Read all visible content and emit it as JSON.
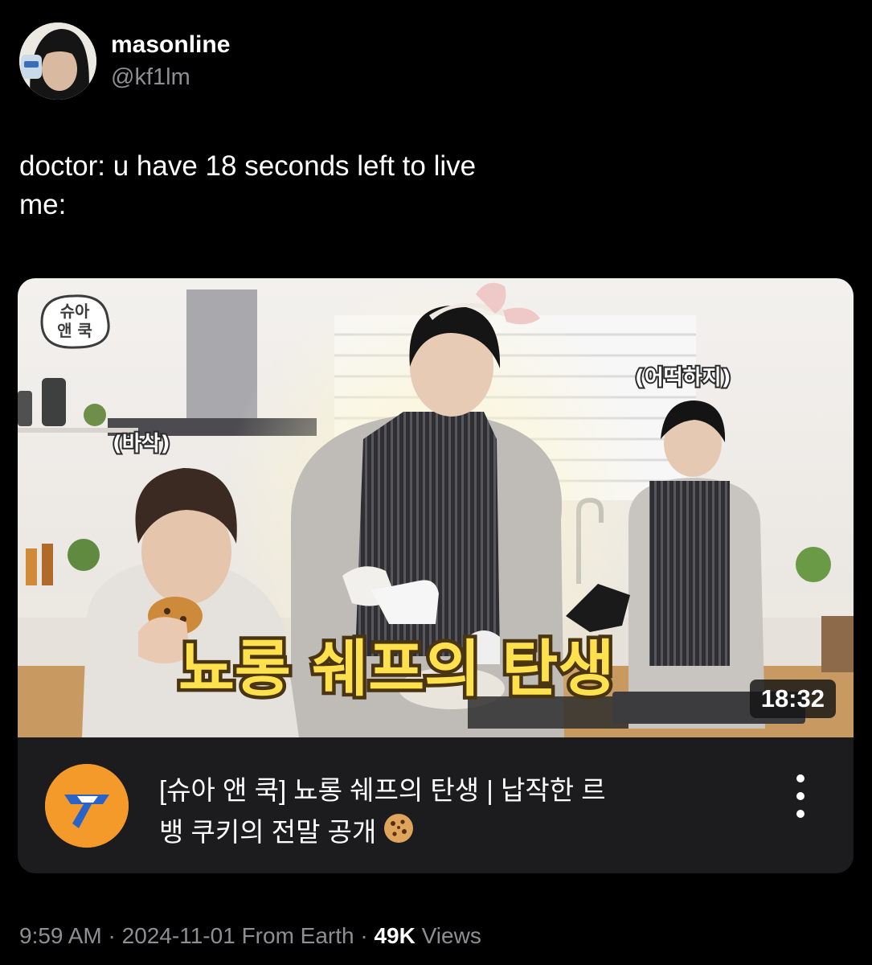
{
  "tweet": {
    "display_name": "masonline",
    "handle": "@kf1lm",
    "text_line1": "doctor: u have 18 seconds left to live",
    "text_line2": "me:"
  },
  "video_card": {
    "thumbnail": {
      "logo_text_top": "슈아",
      "logo_text_bottom": "앤 쿡",
      "caption_left": "(바삭)",
      "caption_right": "(어떡하지)",
      "headline": "뇨롱 쉐프의 탄생",
      "duration": "18:32"
    },
    "title_line1": "[슈아 앤 쿡] 뇨롱 쉐프의 탄생 | 납작한 르",
    "title_line2": "뱅 쿠키의 전말 공개",
    "cookie_emoji_icon": "cookie-icon",
    "more_icon": "more-vertical-icon"
  },
  "meta": {
    "time": "9:59 AM",
    "separator": " · ",
    "date": "2024-11-01",
    "location": "From Earth",
    "views_count": "49K",
    "views_label": "Views"
  },
  "colors": {
    "background": "#000000",
    "secondary_text": "#8e8e93",
    "card_background": "#1c1c1e",
    "channel_logo": "#f39a2b",
    "headline_yellow": "#ffe14d"
  }
}
